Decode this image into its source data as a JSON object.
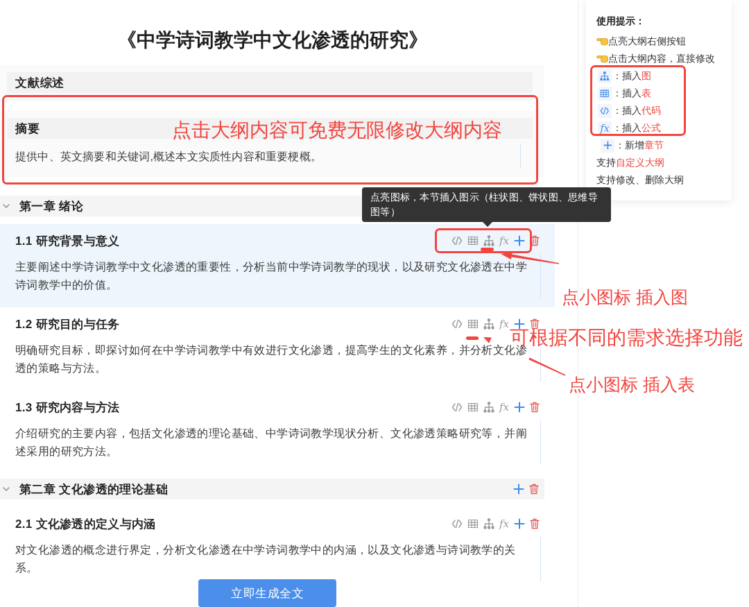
{
  "title": "《中学诗词教学中文化渗透的研究》",
  "front_matter": [
    {
      "title": "文献综述"
    },
    {
      "title": "摘要",
      "description": "提供中、英文摘要和关键词,概述本文实质性内容和重要梗概。"
    }
  ],
  "chapters": [
    {
      "title": "第一章 绪论",
      "expanded": true,
      "sections": [
        {
          "title": "1.1 研究背景与意义",
          "selected": true,
          "description": "主要阐述中学诗词教学中文化渗透的重要性，分析当前中学诗词教学的现状，以及研究文化渗透在中学诗词教学中的价值。",
          "tools": [
            {
              "kind": "code"
            },
            {
              "kind": "table"
            },
            {
              "kind": "tree"
            },
            {
              "kind": "formula",
              "label": "fx"
            },
            {
              "kind": "add"
            },
            {
              "kind": "delete"
            }
          ]
        },
        {
          "title": "1.2 研究目的与任务",
          "selected": false,
          "description": "明确研究目标，即探讨如何在中学诗词教学中有效进行文化渗透，提高学生的文化素养，并分析文化渗透的策略与方法。",
          "tools": [
            {
              "kind": "code"
            },
            {
              "kind": "table"
            },
            {
              "kind": "tree"
            },
            {
              "kind": "formula",
              "label": "fx"
            },
            {
              "kind": "add"
            },
            {
              "kind": "delete"
            }
          ]
        },
        {
          "title": "1.3 研究内容与方法",
          "selected": false,
          "description": "介绍研究的主要内容，包括文化渗透的理论基础、中学诗词教学现状分析、文化渗透策略研究等，并阐述采用的研究方法。",
          "tools": [
            {
              "kind": "code"
            },
            {
              "kind": "table"
            },
            {
              "kind": "tree"
            },
            {
              "kind": "formula",
              "label": "fx"
            },
            {
              "kind": "add"
            },
            {
              "kind": "delete"
            }
          ]
        }
      ]
    },
    {
      "title": "第二章 文化渗透的理论基础",
      "expanded": true,
      "tools": [
        {
          "kind": "add"
        },
        {
          "kind": "delete"
        }
      ],
      "sections": [
        {
          "title": "2.1 文化渗透的定义与内涵",
          "selected": false,
          "description": "对文化渗透的概念进行界定，分析文化渗透在中学诗词教学中的内涵，以及文化渗透与诗词教学的关系。",
          "tools": [
            {
              "kind": "code"
            },
            {
              "kind": "table"
            },
            {
              "kind": "tree"
            },
            {
              "kind": "formula",
              "label": "fx"
            },
            {
              "kind": "add"
            },
            {
              "kind": "delete"
            }
          ]
        }
      ]
    }
  ],
  "help_panel": {
    "title": "使用提示：",
    "items": [
      {
        "kind": "hand",
        "text": "点亮大纲右侧按钮"
      },
      {
        "kind": "hand",
        "text": "点击大纲内容，直接修改"
      },
      {
        "kind": "tree",
        "text": "：插入",
        "highlight": "图"
      },
      {
        "kind": "table",
        "text": "：插入",
        "highlight": "表"
      },
      {
        "kind": "code",
        "text": "：插入",
        "highlight": "代码"
      },
      {
        "kind": "formula",
        "symbol": "fx",
        "text": "：插入",
        "highlight": "公式"
      },
      {
        "kind": "add",
        "text": "：新增",
        "highlight": "章节"
      },
      {
        "kind": "plain",
        "text": "支持",
        "highlight": "自定义大纲"
      },
      {
        "kind": "plain",
        "text": "支持修改、删除大纲"
      }
    ]
  },
  "tooltip": {
    "text": "点亮图标，本节插入图示（柱状图、饼状图、思维导图等）"
  },
  "generate_button": {
    "label": "立即生成全文"
  },
  "annotations": [
    {
      "kind": "frame"
    },
    {
      "kind": "note",
      "text": "点击大纲内容可免费无限修改大纲内容"
    },
    {
      "kind": "frame"
    },
    {
      "kind": "underline"
    },
    {
      "kind": "arrow"
    },
    {
      "kind": "note",
      "text": "点小图标 插入图"
    },
    {
      "kind": "underline"
    },
    {
      "kind": "arrow"
    },
    {
      "kind": "note",
      "text": "可根据不同的需求选择功能"
    },
    {
      "kind": "note",
      "text": "点小图标 插入表"
    },
    {
      "kind": "frame"
    }
  ]
}
